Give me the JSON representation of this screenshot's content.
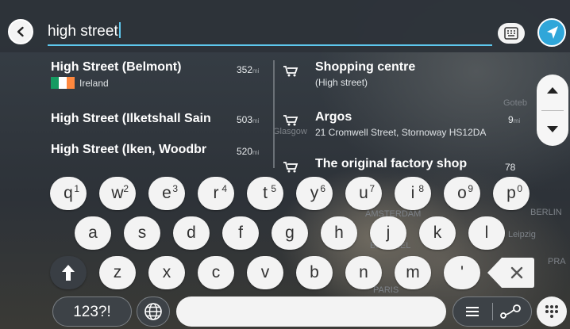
{
  "map": {
    "labels": [
      "Glasgow",
      "Goteb",
      "BERLIN",
      "Leipzig",
      "PRA",
      "AMSTERDAM",
      "BRUSSEL",
      "PARIS"
    ]
  },
  "search": {
    "query": "high street"
  },
  "results_left": [
    {
      "title": "High Street (Belmont)",
      "subtitle": "Ireland",
      "distance": "352",
      "unit": "mi"
    },
    {
      "title": "High Street (Ilketshall Sain",
      "distance": "503",
      "unit": "mi"
    },
    {
      "title": "High Street (Iken, Woodbr",
      "distance": "520",
      "unit": "mi"
    }
  ],
  "results_right": [
    {
      "title": "Shopping centre",
      "subtitle": "(High street)"
    },
    {
      "title": "Argos",
      "subtitle": "21 Cromwell Street, Stornoway HS12DA",
      "distance": "9",
      "unit": "mi"
    },
    {
      "title": "The original factory shop",
      "distance": "78"
    }
  ],
  "keyboard": {
    "row1": [
      {
        "k": "q",
        "n": "1"
      },
      {
        "k": "w",
        "n": "2"
      },
      {
        "k": "e",
        "n": "3"
      },
      {
        "k": "r",
        "n": "4"
      },
      {
        "k": "t",
        "n": "5"
      },
      {
        "k": "y",
        "n": "6"
      },
      {
        "k": "u",
        "n": "7"
      },
      {
        "k": "i",
        "n": "8"
      },
      {
        "k": "o",
        "n": "9"
      },
      {
        "k": "p",
        "n": "0"
      }
    ],
    "row2": [
      "a",
      "s",
      "d",
      "f",
      "g",
      "h",
      "j",
      "k",
      "l"
    ],
    "row3": [
      "z",
      "x",
      "c",
      "v",
      "b",
      "n",
      "m",
      "'"
    ],
    "numbers_label": "123?!"
  },
  "colors": {
    "accent": "#2fa6d9",
    "underline": "#5ec8ee"
  }
}
